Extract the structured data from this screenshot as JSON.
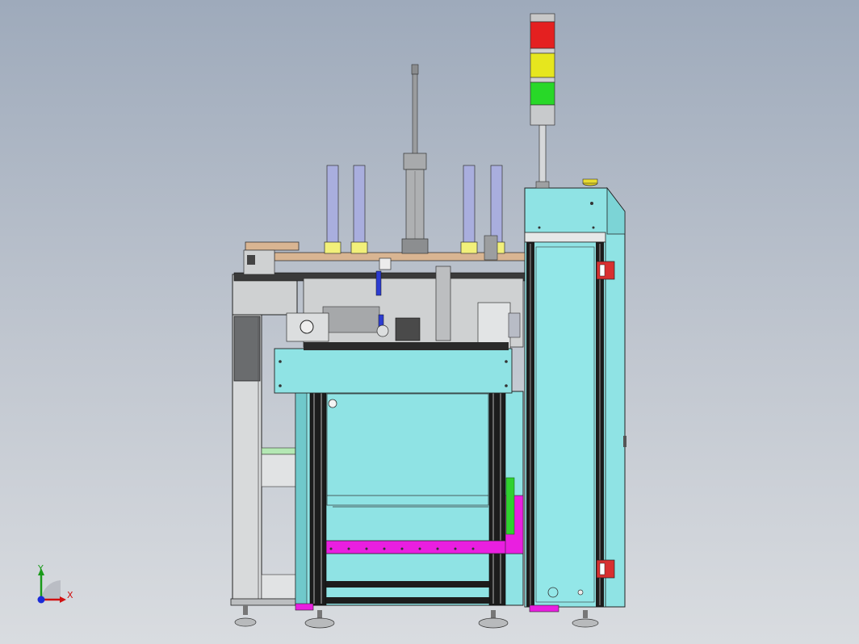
{
  "viewport": {
    "background_top": "#9eaabb",
    "background_bottom": "#d9dce0"
  },
  "colors": {
    "cabinet": "#8fe3e4",
    "cabinet_dark": "#6fc6c8",
    "frame_gray": "#c9cbcc",
    "frame_dark": "#1e1e1e",
    "plate_wood": "#d9b592",
    "magenta_rail": "#e91fe0",
    "green_guide": "#2fd12f",
    "red_bracket": "#d83030",
    "tower_red": "#e42020",
    "tower_yellow": "#e6e61e",
    "tower_green": "#28d828",
    "cylinder_lavender": "#a9aede",
    "cylinder_yellow": "#f2f07a",
    "blue_part": "#2c3cd0"
  },
  "model": {
    "name": "automation-machine",
    "parts": [
      "light-tower",
      "main-cabinet",
      "top-plate",
      "vertical-cylinders",
      "center-actuator",
      "work-module",
      "lower-frame",
      "left-conveyor",
      "leveling-feet"
    ]
  },
  "triad": {
    "x_label": "X",
    "y_label": "Y",
    "x_color": "#d01010",
    "y_color": "#1a9a1a",
    "z_color": "#1b2bd8"
  }
}
